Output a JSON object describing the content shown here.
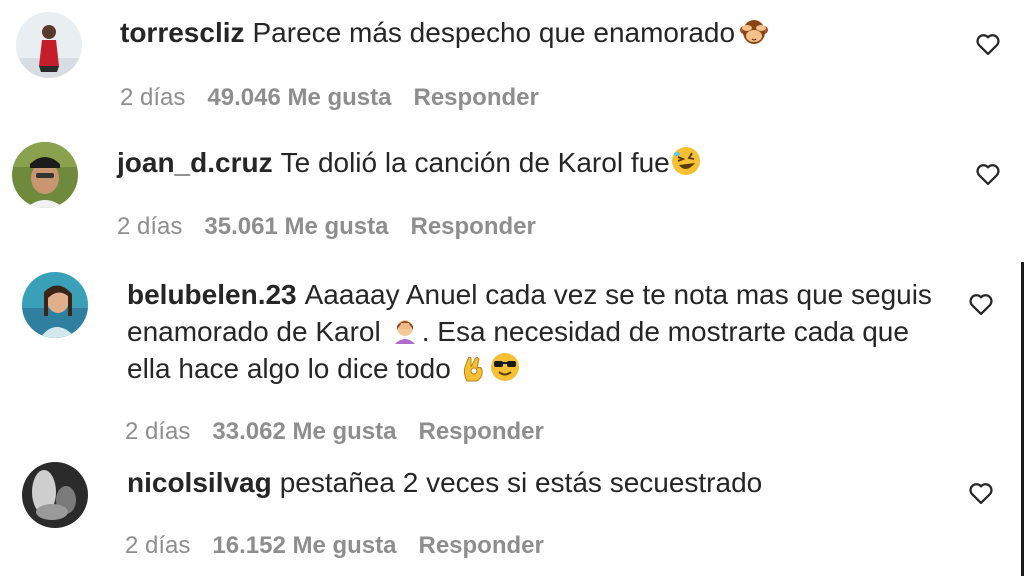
{
  "comments": [
    {
      "username": "torrescliz",
      "text": "Parece más despecho que enamorado",
      "emojis": [
        "see-no-evil-monkey"
      ],
      "time": "2 días",
      "likes": "49.046 Me gusta",
      "reply": "Responder"
    },
    {
      "username": "joan_d.cruz",
      "text": "Te dolió la canción de Karol fue",
      "emojis": [
        "rolling-laughing-face"
      ],
      "time": "2 días",
      "likes": "35.061 Me gusta",
      "reply": "Responder"
    },
    {
      "username": "belubelen.23",
      "text_part1": "Aaaaay Anuel cada vez se te nota mas que seguis enamorado de Karol",
      "text_part2": ". Esa necesidad de mostrarte cada que ella hace algo lo dice todo",
      "emojis": [
        "facepalm-woman",
        "ok-hand",
        "sunglasses-face"
      ],
      "time": "2 días",
      "likes": "33.062 Me gusta",
      "reply": "Responder"
    },
    {
      "username": "nicolsilvag",
      "text": "pestañea 2 veces si estás secuestrado",
      "emojis": [],
      "time": "2 días",
      "likes": "16.152 Me gusta",
      "reply": "Responder"
    }
  ],
  "icons": {
    "like": "heart-outline-icon"
  },
  "colors": {
    "text": "#262626",
    "meta": "#8e8e8e",
    "background": "#ffffff"
  }
}
